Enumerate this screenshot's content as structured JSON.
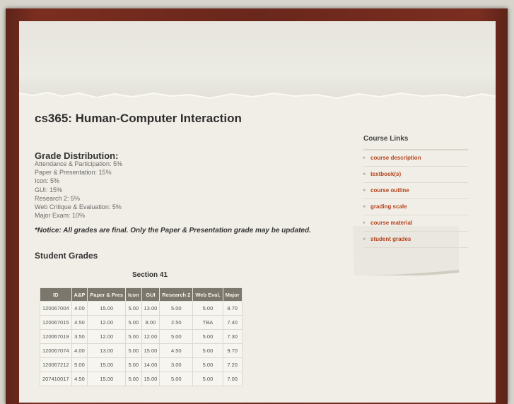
{
  "page": {
    "title": "cs365: Human-Computer Interaction"
  },
  "grade_distribution": {
    "heading": "Grade Distribution:",
    "items": [
      "Attendance & Participation: 5%",
      "Paper & Presentation: 15%",
      "Icon: 5%",
      "GUI: 15%",
      "Research 2: 5%",
      "Web Critique & Evaluation: 5%",
      "Major Exam: 10%"
    ],
    "notice": "*Notice: All grades are final. Only the Paper & Presentation grade may be updated."
  },
  "student_grades": {
    "heading": "Student Grades",
    "section": "Section 41",
    "columns": [
      "ID",
      "A&P",
      "Paper & Pres",
      "Icon",
      "GUI",
      "Research 2",
      "Web Eval.",
      "Major"
    ],
    "rows": [
      [
        "120067004",
        "4.00",
        "15.00",
        "5.00",
        "13.00",
        "5.00",
        "5.00",
        "8.70"
      ],
      [
        "120067015",
        "4.50",
        "12.00",
        "5.00",
        "8.00",
        "2.50",
        "TBA",
        "7.40"
      ],
      [
        "120067019",
        "3.50",
        "12.00",
        "5.00",
        "12.00",
        "5.00",
        "5.00",
        "7.30"
      ],
      [
        "120067074",
        "4.00",
        "13.00",
        "5.00",
        "15.00",
        "4.50",
        "5.00",
        "9.70"
      ],
      [
        "120067212",
        "5.00",
        "15.00",
        "5.00",
        "14.00",
        "3.00",
        "5.00",
        "7.20"
      ],
      [
        "207410017",
        "4.50",
        "15.00",
        "5.00",
        "15.00",
        "5.00",
        "5.00",
        "7.00"
      ]
    ]
  },
  "sidebar": {
    "heading": "Course Links",
    "bullet_icon": "arrow-bullet-icon",
    "link_color": "#b5441c",
    "links": [
      "course description",
      "textbook(s)",
      "course outline",
      "grading scale",
      "course material",
      "student grades"
    ]
  }
}
